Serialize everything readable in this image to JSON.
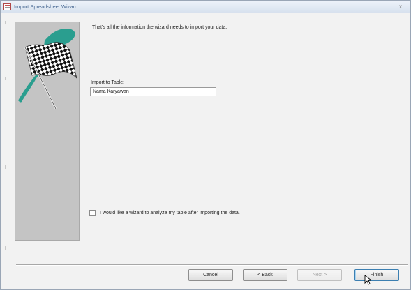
{
  "window": {
    "title": "Import Spreadsheet Wizard",
    "close_glyph": "x"
  },
  "main": {
    "message": "That's all the information the wizard needs to import your data.",
    "import_label": "Import to Table:",
    "import_value": "Nama Karyawan",
    "analyze_checkbox_label": "I would like a wizard to analyze my table after importing the data.",
    "analyze_checked": false
  },
  "buttons": {
    "cancel": "Cancel",
    "back": "< Back",
    "next": "Next >",
    "finish": "Finish"
  },
  "colors": {
    "accent": "#3c7fb1",
    "panel": "#c4c4c4",
    "flag_pole": "#1a9a8a"
  }
}
